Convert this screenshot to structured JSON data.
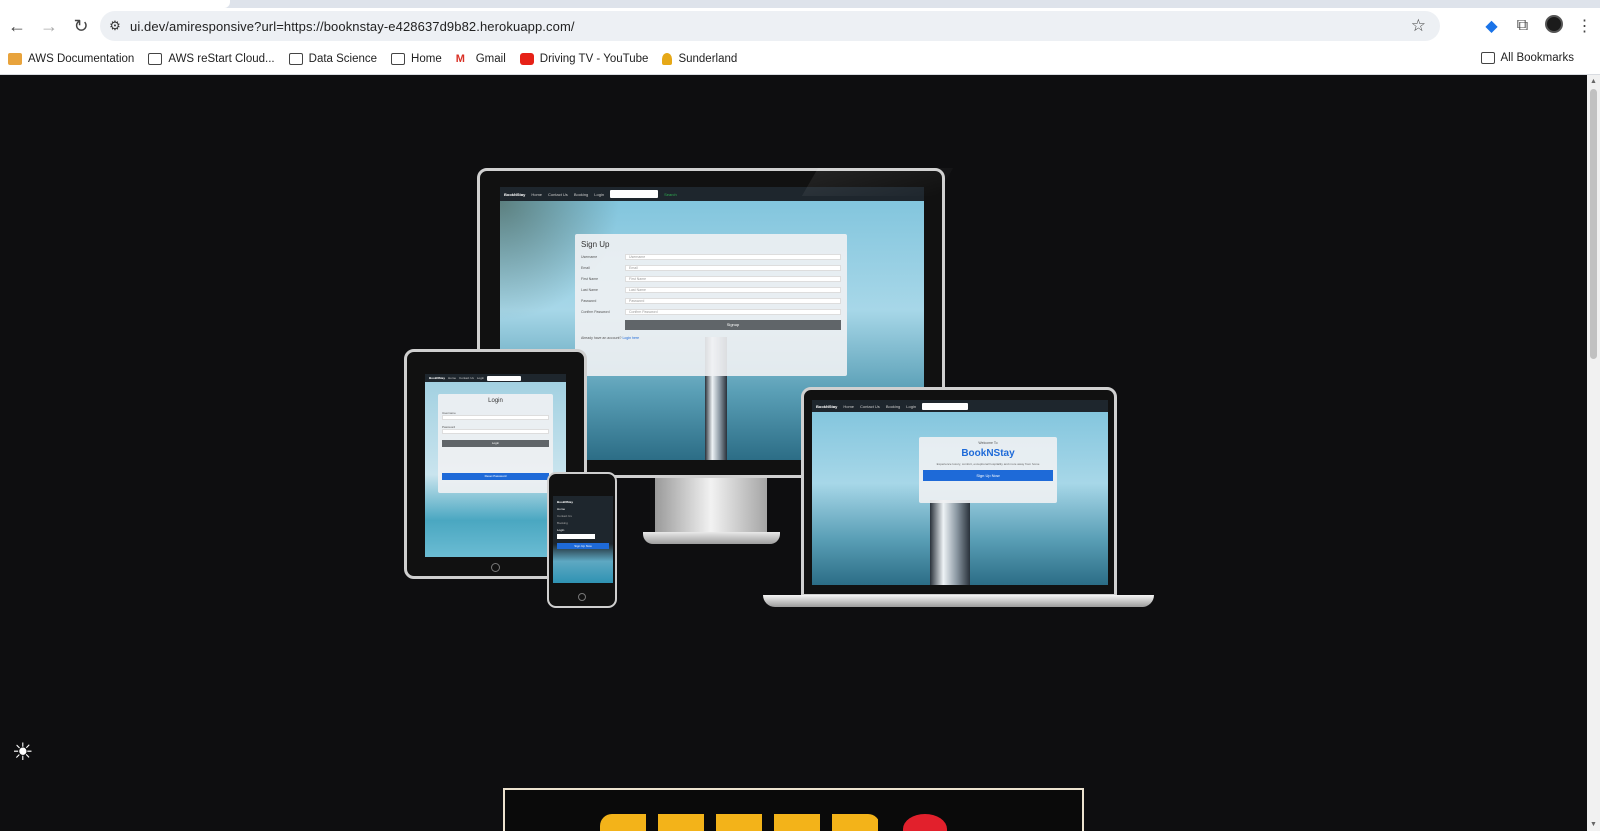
{
  "browser": {
    "url": "ui.dev/amiresponsive?url=https://booknstay-e428637d9b82.herokuapp.com/",
    "bookmarks": [
      "AWS Documentation",
      "AWS reStart Cloud...",
      "Data Science",
      "Home",
      "Gmail",
      "Driving TV - YouTube",
      "Sunderland"
    ],
    "all_bookmarks": "All Bookmarks"
  },
  "site": {
    "brand": "BookNStay",
    "nav": [
      "Home",
      "Contact Us",
      "Booking",
      "Login"
    ],
    "search_placeholder": "Search",
    "search_button": "Search"
  },
  "desktop": {
    "title": "Sign Up",
    "fields": [
      "Username",
      "Email",
      "First Name",
      "Last Name",
      "Password",
      "Confirm Password"
    ],
    "button": "Signup",
    "footer": "Already have an account?",
    "footer_link": "Login here"
  },
  "tablet": {
    "title": "Login",
    "fields": [
      "Username",
      "Password"
    ],
    "button": "Login",
    "button2": "Reset Password"
  },
  "laptop": {
    "welcome": "Welcome To",
    "title": "BookNStay",
    "tagline": "Experience luxury, comfort, exceptional hospitality and more away from home",
    "button": "Sign Up Now"
  },
  "phone": {
    "nav": [
      "Home",
      "Contact Us",
      "Booking",
      "Login"
    ],
    "button": "Sign Up Now"
  }
}
